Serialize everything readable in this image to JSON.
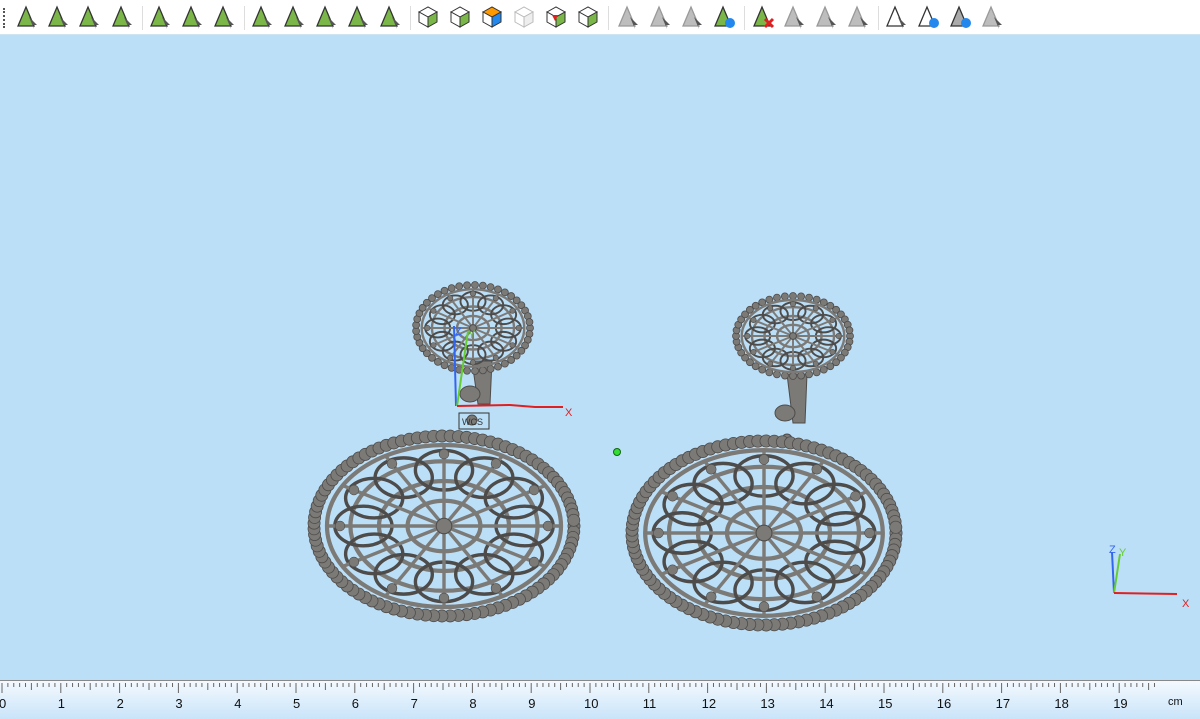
{
  "toolbar": {
    "buttons": [
      {
        "name": "select-vertex",
        "group": 1,
        "style": "green"
      },
      {
        "name": "select-face",
        "group": 1,
        "style": "green"
      },
      {
        "name": "select-surface",
        "group": 1,
        "style": "green"
      },
      {
        "name": "select-shell",
        "group": 1,
        "style": "green"
      },
      {
        "name": "draw-rectangle",
        "group": 2,
        "style": "green"
      },
      {
        "name": "draw-blob",
        "group": 2,
        "style": "green"
      },
      {
        "name": "draw-curve",
        "group": 2,
        "style": "green"
      },
      {
        "name": "triangulate",
        "group": 3,
        "style": "green"
      },
      {
        "name": "split-circle",
        "group": 3,
        "style": "green"
      },
      {
        "name": "star-split",
        "group": 3,
        "style": "green"
      },
      {
        "name": "radial-split",
        "group": 3,
        "style": "green"
      },
      {
        "name": "radial-split-2",
        "group": 3,
        "style": "green"
      },
      {
        "name": "select-box",
        "group": 4,
        "style": "cube"
      },
      {
        "name": "select-box-green",
        "group": 4,
        "style": "cube"
      },
      {
        "name": "select-box-color",
        "group": 4,
        "style": "cubecolor"
      },
      {
        "name": "select-box-disabled",
        "group": 4,
        "style": "cubegray"
      },
      {
        "name": "select-box-red",
        "group": 4,
        "style": "cubered"
      },
      {
        "name": "select-box-move",
        "group": 4,
        "style": "cube"
      },
      {
        "name": "pick-gray",
        "group": 5,
        "style": "gray"
      },
      {
        "name": "pick-gray-2",
        "group": 5,
        "style": "gray"
      },
      {
        "name": "pick-gray-3",
        "group": 5,
        "style": "gray"
      },
      {
        "name": "swap-layers",
        "group": 5,
        "style": "greenblue"
      },
      {
        "name": "delete-part",
        "group": 6,
        "style": "greenred"
      },
      {
        "name": "copy-gray",
        "group": 6,
        "style": "gray"
      },
      {
        "name": "paste-gray",
        "group": 6,
        "style": "gray"
      },
      {
        "name": "flat-gray",
        "group": 6,
        "style": "gray"
      },
      {
        "name": "view-hidden",
        "group": 7,
        "style": "white"
      },
      {
        "name": "view-swap",
        "group": 7,
        "style": "whiteblue"
      },
      {
        "name": "view-show",
        "group": 7,
        "style": "grayblue"
      },
      {
        "name": "view-face",
        "group": 7,
        "style": "gray"
      }
    ]
  },
  "axes": {
    "x": "X",
    "y": "Y",
    "z": "Z",
    "wcs": "WCS"
  },
  "ruler": {
    "labels": [
      "0",
      "1",
      "2",
      "3",
      "4",
      "5",
      "6",
      "7",
      "8",
      "9",
      "10",
      "11",
      "12",
      "13",
      "14",
      "15",
      "16",
      "17",
      "18",
      "19"
    ],
    "unit": "cm"
  },
  "colors": {
    "viewport": "#bcdff8",
    "model": "#7a7875",
    "x_axis": "#e02020",
    "y_axis": "#66cc33",
    "z_axis": "#3366ee"
  }
}
